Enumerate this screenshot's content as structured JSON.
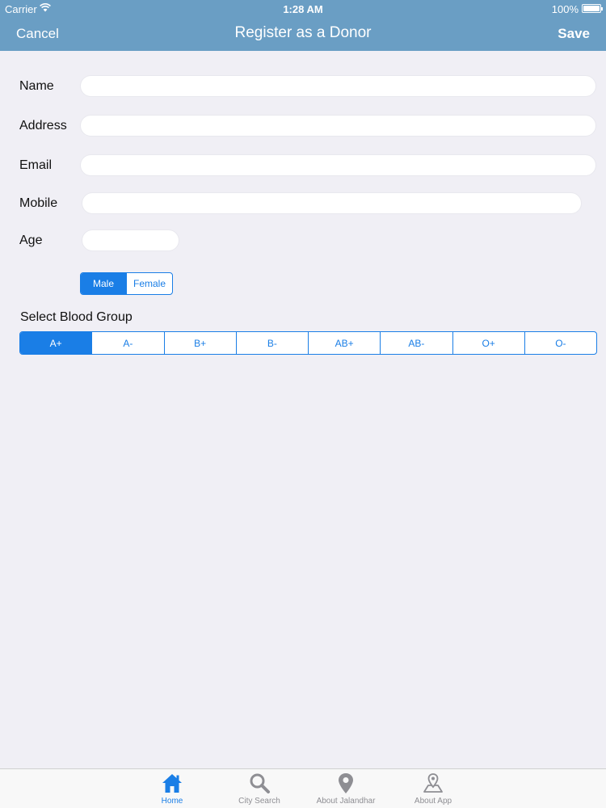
{
  "status_bar": {
    "carrier": "Carrier",
    "time": "1:28 AM",
    "battery": "100%"
  },
  "nav": {
    "cancel": "Cancel",
    "title": "Register as a Donor",
    "save": "Save"
  },
  "form": {
    "name_label": "Name",
    "address_label": "Address",
    "email_label": "Email",
    "mobile_label": "Mobile",
    "age_label": "Age",
    "name_value": "",
    "address_value": "",
    "email_value": "",
    "mobile_value": "",
    "age_value": ""
  },
  "gender": {
    "options": [
      "Male",
      "Female"
    ],
    "selected": "Male"
  },
  "blood_group": {
    "title": "Select Blood Group",
    "options": [
      "A+",
      "A-",
      "B+",
      "B-",
      "AB+",
      "AB-",
      "O+",
      "O-"
    ],
    "selected": "A+"
  },
  "tabs": [
    {
      "label": "Home",
      "icon": "home-icon",
      "active": true
    },
    {
      "label": "City Search",
      "icon": "search-icon",
      "active": false
    },
    {
      "label": "About Jalandhar",
      "icon": "location-pin-icon",
      "active": false
    },
    {
      "label": "About App",
      "icon": "map-pin-icon",
      "active": false
    }
  ],
  "colors": {
    "header": "#6a9ec4",
    "accent": "#1a7ee6",
    "background": "#f0eff5"
  }
}
